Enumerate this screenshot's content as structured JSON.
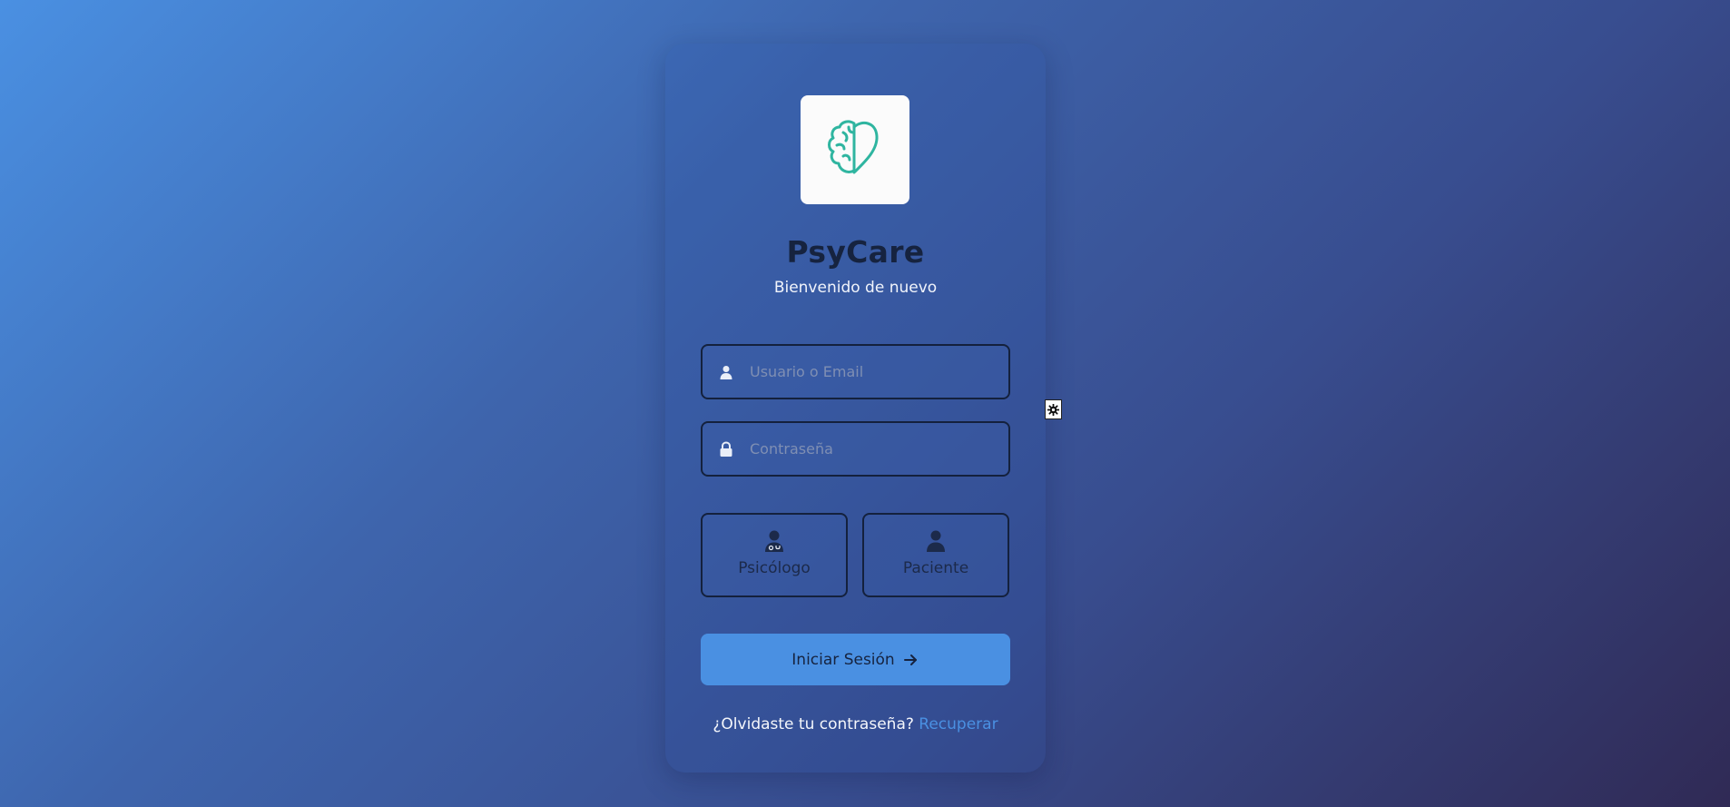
{
  "app": {
    "title": "PsyCare",
    "subtitle": "Bienvenido de nuevo",
    "logo": "brain-heart-logo"
  },
  "form": {
    "username": {
      "placeholder": "Usuario o Email",
      "value": "",
      "icon": "user-icon"
    },
    "password": {
      "placeholder": "Contraseña",
      "value": "",
      "icon": "lock-icon"
    },
    "roles": [
      {
        "label": "Psicólogo",
        "icon": "doctor-icon"
      },
      {
        "label": "Paciente",
        "icon": "user-icon"
      }
    ],
    "submit": {
      "label": "Iniciar Sesión",
      "icon": "arrow-right-icon"
    }
  },
  "recover": {
    "text": "¿Olvidaste tu contraseña?",
    "link": "Recuperar"
  },
  "theme_toggle": {
    "icon": "gear-icon"
  },
  "colors": {
    "accent": "#4a90e2",
    "logo_teal": "#2fb5a0",
    "title_dark": "#16233f"
  }
}
